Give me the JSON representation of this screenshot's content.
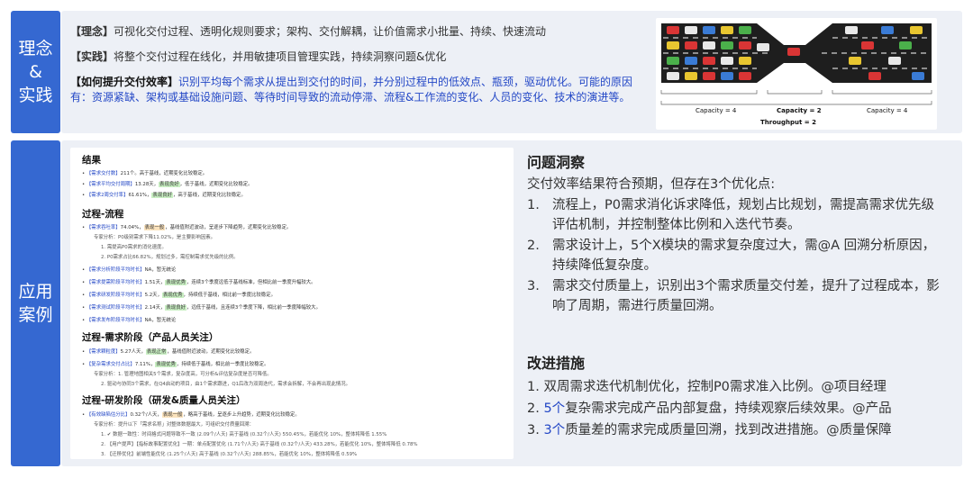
{
  "sections": {
    "concept_label": [
      "理念",
      "&",
      "实践"
    ],
    "case_label": [
      "应用",
      "案例"
    ]
  },
  "concept": {
    "line1_tag": "【理念】",
    "line1_text": "可视化交付过程、透明化规则要求；架构、交付解耦，让价值需求小批量、持续、快速流动",
    "line2_tag": "【实践】",
    "line2_text": "将整个交付过程在线化，并用敏捷项目管理实践，持续洞察问题&优化",
    "line3_tag": "【如何提升交付效率】",
    "line3_text": "识别平均每个需求从提出到交付的时间，并分别过程中的低效点、瓶颈，驱动优化。可能的原因有：资源紧缺、架构或基础设施问题、等待时间导致的流动停滞、流程&工作流的变化、人员的变化、技术的演进等。"
  },
  "diagram": {
    "capacity_left": "Capacity = 4",
    "capacity_mid": "Capacity = 2",
    "capacity_right": "Capacity = 4",
    "throughput": "Throughput = 2"
  },
  "report": {
    "h_result": "结果",
    "r1_k": "【需求交付数】",
    "r1_t": "211个。高于基线，近期变化比较稳定。",
    "r2_k": "【需求平均交付周期】",
    "r2_a": "13.28天，",
    "r2_tag": "表现良好",
    "r2_b": "，低于基线，近期变化比较稳定。",
    "r3_k": "【需求2周交付率】",
    "r3_a": "61.61%，",
    "r3_tag": "表现良好",
    "r3_b": "，高于基线，近期变化比较稳定。",
    "h_flow": "过程-流程",
    "f1_k": "【需求吞吐率】",
    "f1_a": "74.04%，",
    "f1_tag": "表现一般",
    "f1_b": "，基线值附近波动，呈逐步下降趋势，近期变化比较稳定。",
    "f1_s1": "专家分析：P0级别需求下降11.02%，是主要影响因素。",
    "f1_s2": "1. 需提高P0需求的消化速度。",
    "f1_s3": "2. P0需求占比66.82%，规划过多，需控制需求优先级的比例。",
    "f2_k": "【需求分析阶段平均时长】",
    "f2_t": "NA，暂无统论",
    "f3_k": "【需求提需阶段平均时长】",
    "f3_a": "1.51天，",
    "f3_tag": "表现优秀",
    "f3_b": "，连续3个季度远低于基线标准，但相比前一季度升幅较大。",
    "f4_k": "【需求研发阶段平均时长】",
    "f4_a": "5.2天，",
    "f4_tag": "表现优秀",
    "f4_b": "，持续低于基线，相比前一季度比较稳定。",
    "f5_k": "【需求测试阶段平均时长】",
    "f5_a": "2.14天，",
    "f5_tag": "表现良好",
    "f5_b": "，远低于基线，且连续3个季度下降，相比前一季度降幅较大。",
    "f6_k": "【需求发布阶段平均时长】",
    "f6_t": "NA，暂无统论",
    "h_req": "过程-需求阶段（产品人员关注）",
    "q1_k": "【需求颗粒度】",
    "q1_a": "5.27人天，",
    "q1_tag": "表现正常",
    "q1_b": "，基线值附近波动，近期变化比较稳定。",
    "q2_k": "【复杂需求交付占比】",
    "q2_a": "7.11%，",
    "q2_tag": "表现优秀",
    "q2_b": "，持续低于基线，相比前一季度比较稳定。",
    "q2_s1": "专家分析：1. 管理地图相关5个需求，复杂度高，可分析&评估复杂度是否可降低。",
    "q2_s2": "2. 驱动与协同3个需求，在Q4启动的项目，由1个需求跟进，Q1后改为双周迭代，需求会拆解，不会再出现此情况。",
    "h_dev": "过程-研发阶段（研发&质量人员关注）",
    "d1_k": "【有效缺陷估分比】",
    "d1_a": "0.32个/人天，",
    "d1_tag": "表现一般",
    "d1_b": "，略高于基线，呈逐步上升趋势，近期变化比较稳定。",
    "d1_s1": "专家分析：提升以下「需求名称」对整体数据最大，可组织交付质量回溯：",
    "d1_s2": "1. ✔ 数据一致性：时间格式问题导致不一致 (2.09个/人天) 高于基线 (0.32个/人天) 550.45%，若能优化 10%，整体将降低 1.55%",
    "d1_s3": "2. 【用户提声】【指标故事配置优化】一期：单点配置优化 (1.71个/人天) 高于基线 (0.32个/人天) 433.28%，若能优化 10%，整体将降低 0.78%",
    "d1_s4": "3. 【迁移优化】前端性能优化 (1.25个/人天) 高于基线 (0.32个/人天) 288.85%，若能优化 10%，整体将降低 0.59%"
  },
  "insight": {
    "title": "问题洞察",
    "intro": "交付效率结果符合预期，但存在3个优化点:",
    "items": [
      {
        "num": "1.",
        "text": "流程上，P0需求消化诉求降低，规划占比规划，需提高需求优先级评估机制，并控制整体比例和入迭代节奏。"
      },
      {
        "num": "2.",
        "text": "需求设计上，5个X模块的需求复杂度过大，需@A 回溯分析原因，持续降低复杂度。"
      },
      {
        "num": "3.",
        "text": "需求交付质量上，识别出3个需求质量交付差，提升了过程成本，影响了周期，需进行质量回溯。"
      }
    ]
  },
  "improvement": {
    "title": "改进措施",
    "i1": "1. 双周需求迭代机制优化，控制P0需求准入比例。@项目经理",
    "i2_num": "2. ",
    "i2_hl": "5个",
    "i2_rest": "复杂需求完成产品内部复盘，持续观察后续效果。@产品",
    "i3_num": "3. ",
    "i3_hl": "3个",
    "i3_rest": "质量差的需求完成质量回溯，找到改进措施。@质量保障"
  }
}
